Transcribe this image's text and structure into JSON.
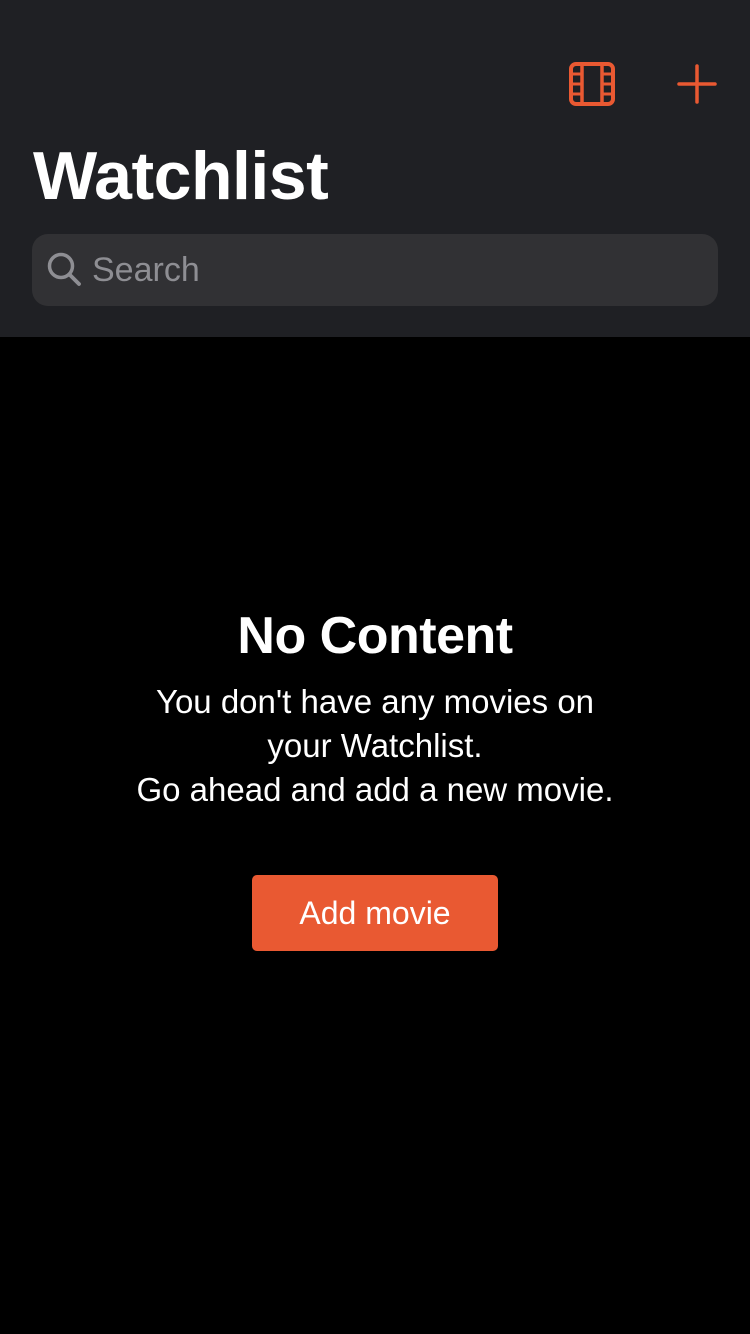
{
  "colors": {
    "accent": "#e95932",
    "navbar_background": "#1f2024",
    "search_background": "#313134",
    "page_background": "#000000",
    "placeholder": "#8e8e93"
  },
  "navbar": {
    "title": "Watchlist",
    "actions": [
      {
        "icon": "film-icon"
      },
      {
        "icon": "plus-icon"
      }
    ],
    "search": {
      "placeholder": "Search",
      "value": "",
      "icon": "search-icon"
    }
  },
  "empty_state": {
    "title": "No Content",
    "message_lines": [
      "You don't have any movies on",
      "your Watchlist.",
      "Go ahead and add a new movie."
    ],
    "button_label": "Add movie"
  }
}
